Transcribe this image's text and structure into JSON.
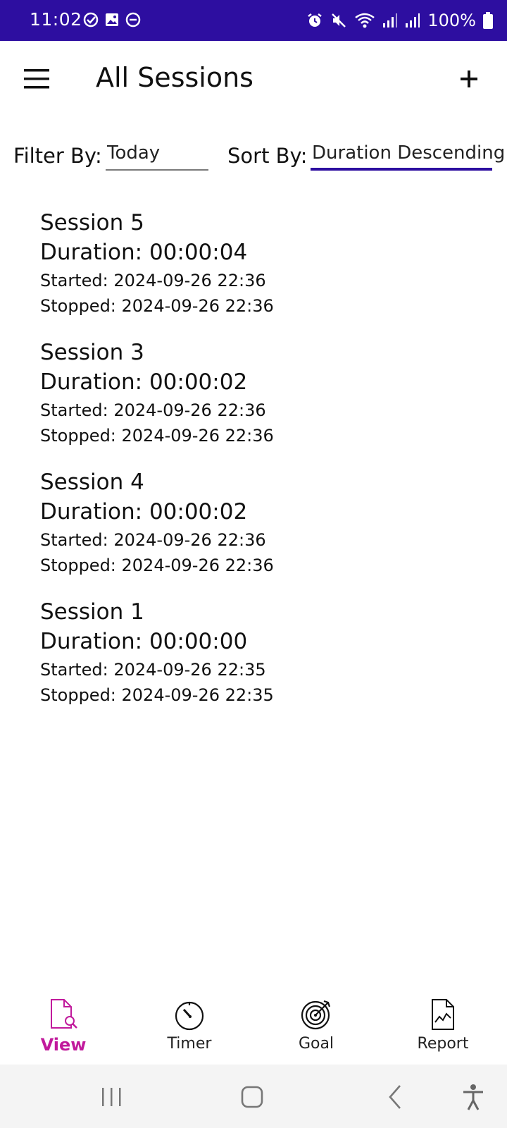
{
  "status_bar": {
    "time": "11:02",
    "battery": "100%",
    "left_icons": [
      "check-circle-icon",
      "image-icon",
      "dnd-icon"
    ],
    "right_icons": [
      "alarm-icon",
      "mute-icon",
      "wifi-icon",
      "signal-icon",
      "signal-icon",
      "battery-icon"
    ],
    "background": "#2d0ea0"
  },
  "app_bar": {
    "title": "All Sessions",
    "menu_icon": "hamburger-menu-icon",
    "add_icon": "plus-icon"
  },
  "controls": {
    "filter_label": "Filter By:",
    "filter_value": "Today",
    "sort_label": "Sort By:",
    "sort_value": "Duration Descending",
    "accent": "#2d0ea0"
  },
  "sessions": [
    {
      "name": "Session 5",
      "duration": "Duration: 00:00:04",
      "started": "Started: 2024-09-26 22:36",
      "stopped": "Stopped: 2024-09-26 22:36"
    },
    {
      "name": "Session 3",
      "duration": "Duration: 00:00:02",
      "started": "Started: 2024-09-26 22:36",
      "stopped": "Stopped: 2024-09-26 22:36"
    },
    {
      "name": "Session 4",
      "duration": "Duration: 00:00:02",
      "started": "Started: 2024-09-26 22:36",
      "stopped": "Stopped: 2024-09-26 22:36"
    },
    {
      "name": "Session 1",
      "duration": "Duration: 00:00:00",
      "started": "Started: 2024-09-26 22:35",
      "stopped": "Stopped: 2024-09-26 22:35"
    }
  ],
  "bottom_nav": {
    "active_color": "#c11a9c",
    "items": [
      {
        "label": "View",
        "icon": "document-search-icon",
        "active": true
      },
      {
        "label": "Timer",
        "icon": "timer-icon",
        "active": false
      },
      {
        "label": "Goal",
        "icon": "target-icon",
        "active": false
      },
      {
        "label": "Report",
        "icon": "report-chart-icon",
        "active": false
      }
    ]
  },
  "system_nav": {
    "icons": [
      "recents-icon",
      "home-icon",
      "back-icon",
      "accessibility-icon"
    ]
  }
}
